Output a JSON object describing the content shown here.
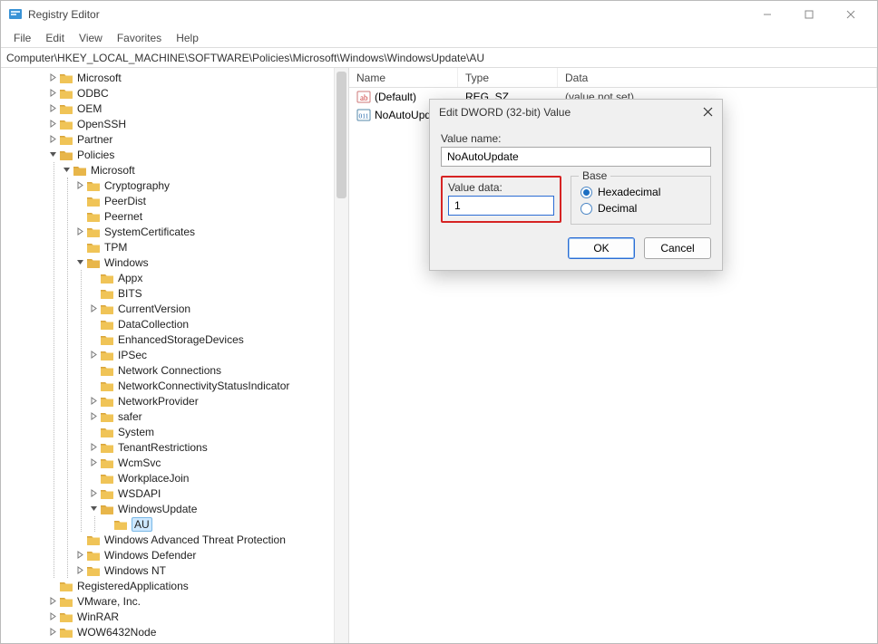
{
  "window": {
    "title": "Registry Editor",
    "controls": {
      "minimize": "—",
      "maximize": "▢",
      "close": "✕"
    }
  },
  "menu": [
    "File",
    "Edit",
    "View",
    "Favorites",
    "Help"
  ],
  "address": "Computer\\HKEY_LOCAL_MACHINE\\SOFTWARE\\Policies\\Microsoft\\Windows\\WindowsUpdate\\AU",
  "tree": {
    "root": [
      {
        "label": "Microsoft",
        "expander": ">"
      },
      {
        "label": "ODBC",
        "expander": ">"
      },
      {
        "label": "OEM",
        "expander": ">"
      },
      {
        "label": "OpenSSH",
        "expander": ">"
      },
      {
        "label": "Partner",
        "expander": ">"
      },
      {
        "label": "Policies",
        "expander": "v",
        "children": [
          {
            "label": "Microsoft",
            "expander": "v",
            "children": [
              {
                "label": "Cryptography",
                "expander": ">"
              },
              {
                "label": "PeerDist",
                "expander": ""
              },
              {
                "label": "Peernet",
                "expander": ""
              },
              {
                "label": "SystemCertificates",
                "expander": ">"
              },
              {
                "label": "TPM",
                "expander": ""
              },
              {
                "label": "Windows",
                "expander": "v",
                "children": [
                  {
                    "label": "Appx",
                    "expander": ""
                  },
                  {
                    "label": "BITS",
                    "expander": ""
                  },
                  {
                    "label": "CurrentVersion",
                    "expander": ">"
                  },
                  {
                    "label": "DataCollection",
                    "expander": ""
                  },
                  {
                    "label": "EnhancedStorageDevices",
                    "expander": ""
                  },
                  {
                    "label": "IPSec",
                    "expander": ">"
                  },
                  {
                    "label": "Network Connections",
                    "expander": ""
                  },
                  {
                    "label": "NetworkConnectivityStatusIndicator",
                    "expander": ""
                  },
                  {
                    "label": "NetworkProvider",
                    "expander": ">"
                  },
                  {
                    "label": "safer",
                    "expander": ">"
                  },
                  {
                    "label": "System",
                    "expander": ""
                  },
                  {
                    "label": "TenantRestrictions",
                    "expander": ">"
                  },
                  {
                    "label": "WcmSvc",
                    "expander": ">"
                  },
                  {
                    "label": "WorkplaceJoin",
                    "expander": ""
                  },
                  {
                    "label": "WSDAPI",
                    "expander": ">"
                  },
                  {
                    "label": "WindowsUpdate",
                    "expander": "v",
                    "children": [
                      {
                        "label": "AU",
                        "expander": "",
                        "selected": true
                      }
                    ]
                  }
                ]
              },
              {
                "label": "Windows Advanced Threat Protection",
                "expander": ""
              },
              {
                "label": "Windows Defender",
                "expander": ">"
              },
              {
                "label": "Windows NT",
                "expander": ">"
              }
            ]
          }
        ]
      },
      {
        "label": "RegisteredApplications",
        "expander": ""
      },
      {
        "label": "VMware, Inc.",
        "expander": ">"
      },
      {
        "label": "WinRAR",
        "expander": ">"
      },
      {
        "label": "WOW6432Node",
        "expander": ">"
      }
    ]
  },
  "list": {
    "columns": {
      "name": "Name",
      "type": "Type",
      "data": "Data"
    },
    "rows": [
      {
        "icon": "string",
        "name": "(Default)",
        "type": "REG_SZ",
        "data": "(value not set)"
      },
      {
        "icon": "dword",
        "name": "NoAutoUpdate",
        "type": "",
        "data": ""
      }
    ]
  },
  "dialog": {
    "title": "Edit DWORD (32-bit) Value",
    "value_name_label": "Value name:",
    "value_name": "NoAutoUpdate",
    "value_data_label": "Value data:",
    "value_data": "1",
    "base_label": "Base",
    "base_hex": "Hexadecimal",
    "base_dec": "Decimal",
    "ok": "OK",
    "cancel": "Cancel"
  }
}
